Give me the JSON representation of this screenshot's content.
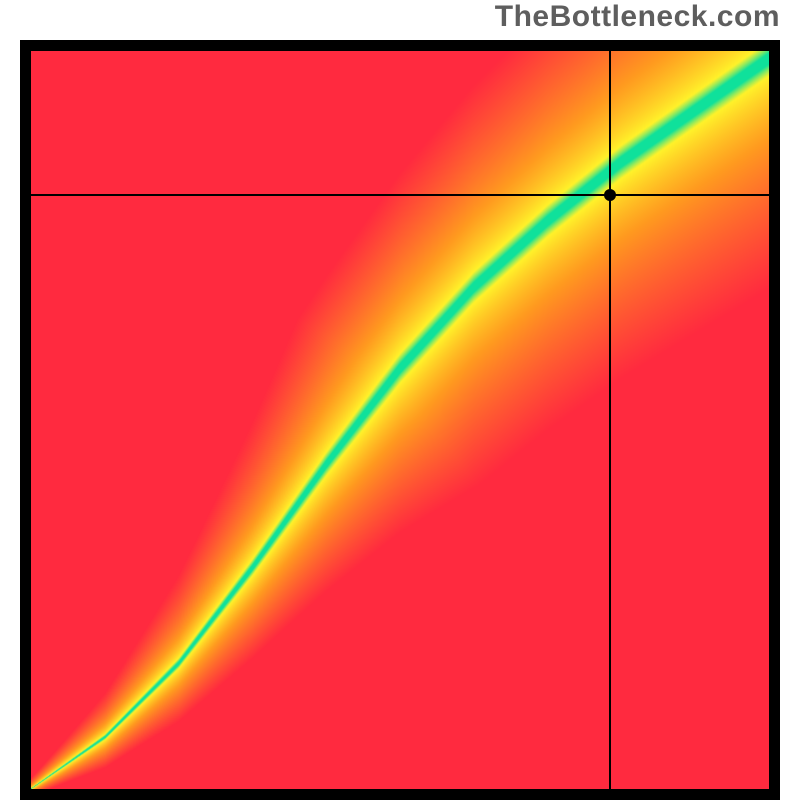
{
  "watermark": "TheBottleneck.com",
  "chart_data": {
    "type": "heatmap",
    "title": "",
    "xlabel": "",
    "ylabel": "",
    "xlim": [
      0,
      100
    ],
    "ylim": [
      0,
      100
    ],
    "description": "Bottleneck heatmap. Green diagonal band = balanced pairing; warm colors = bottleneck. Curve is slightly S-shaped; green band sits above the main diagonal in the upper region.",
    "optimal_curve_samples": [
      {
        "x": 0,
        "y": 0
      },
      {
        "x": 10,
        "y": 7
      },
      {
        "x": 20,
        "y": 17
      },
      {
        "x": 30,
        "y": 30
      },
      {
        "x": 40,
        "y": 44
      },
      {
        "x": 50,
        "y": 57
      },
      {
        "x": 60,
        "y": 68
      },
      {
        "x": 70,
        "y": 77
      },
      {
        "x": 80,
        "y": 85
      },
      {
        "x": 90,
        "y": 92
      },
      {
        "x": 100,
        "y": 99
      }
    ],
    "band_half_width_percent": 6.5,
    "crosshair": {
      "x": 78.5,
      "y": 80.5
    },
    "colors": {
      "optimal": "#0fe19b",
      "near": "#fff22a",
      "mid": "#ff9a1f",
      "far": "#ff2a3f"
    }
  }
}
